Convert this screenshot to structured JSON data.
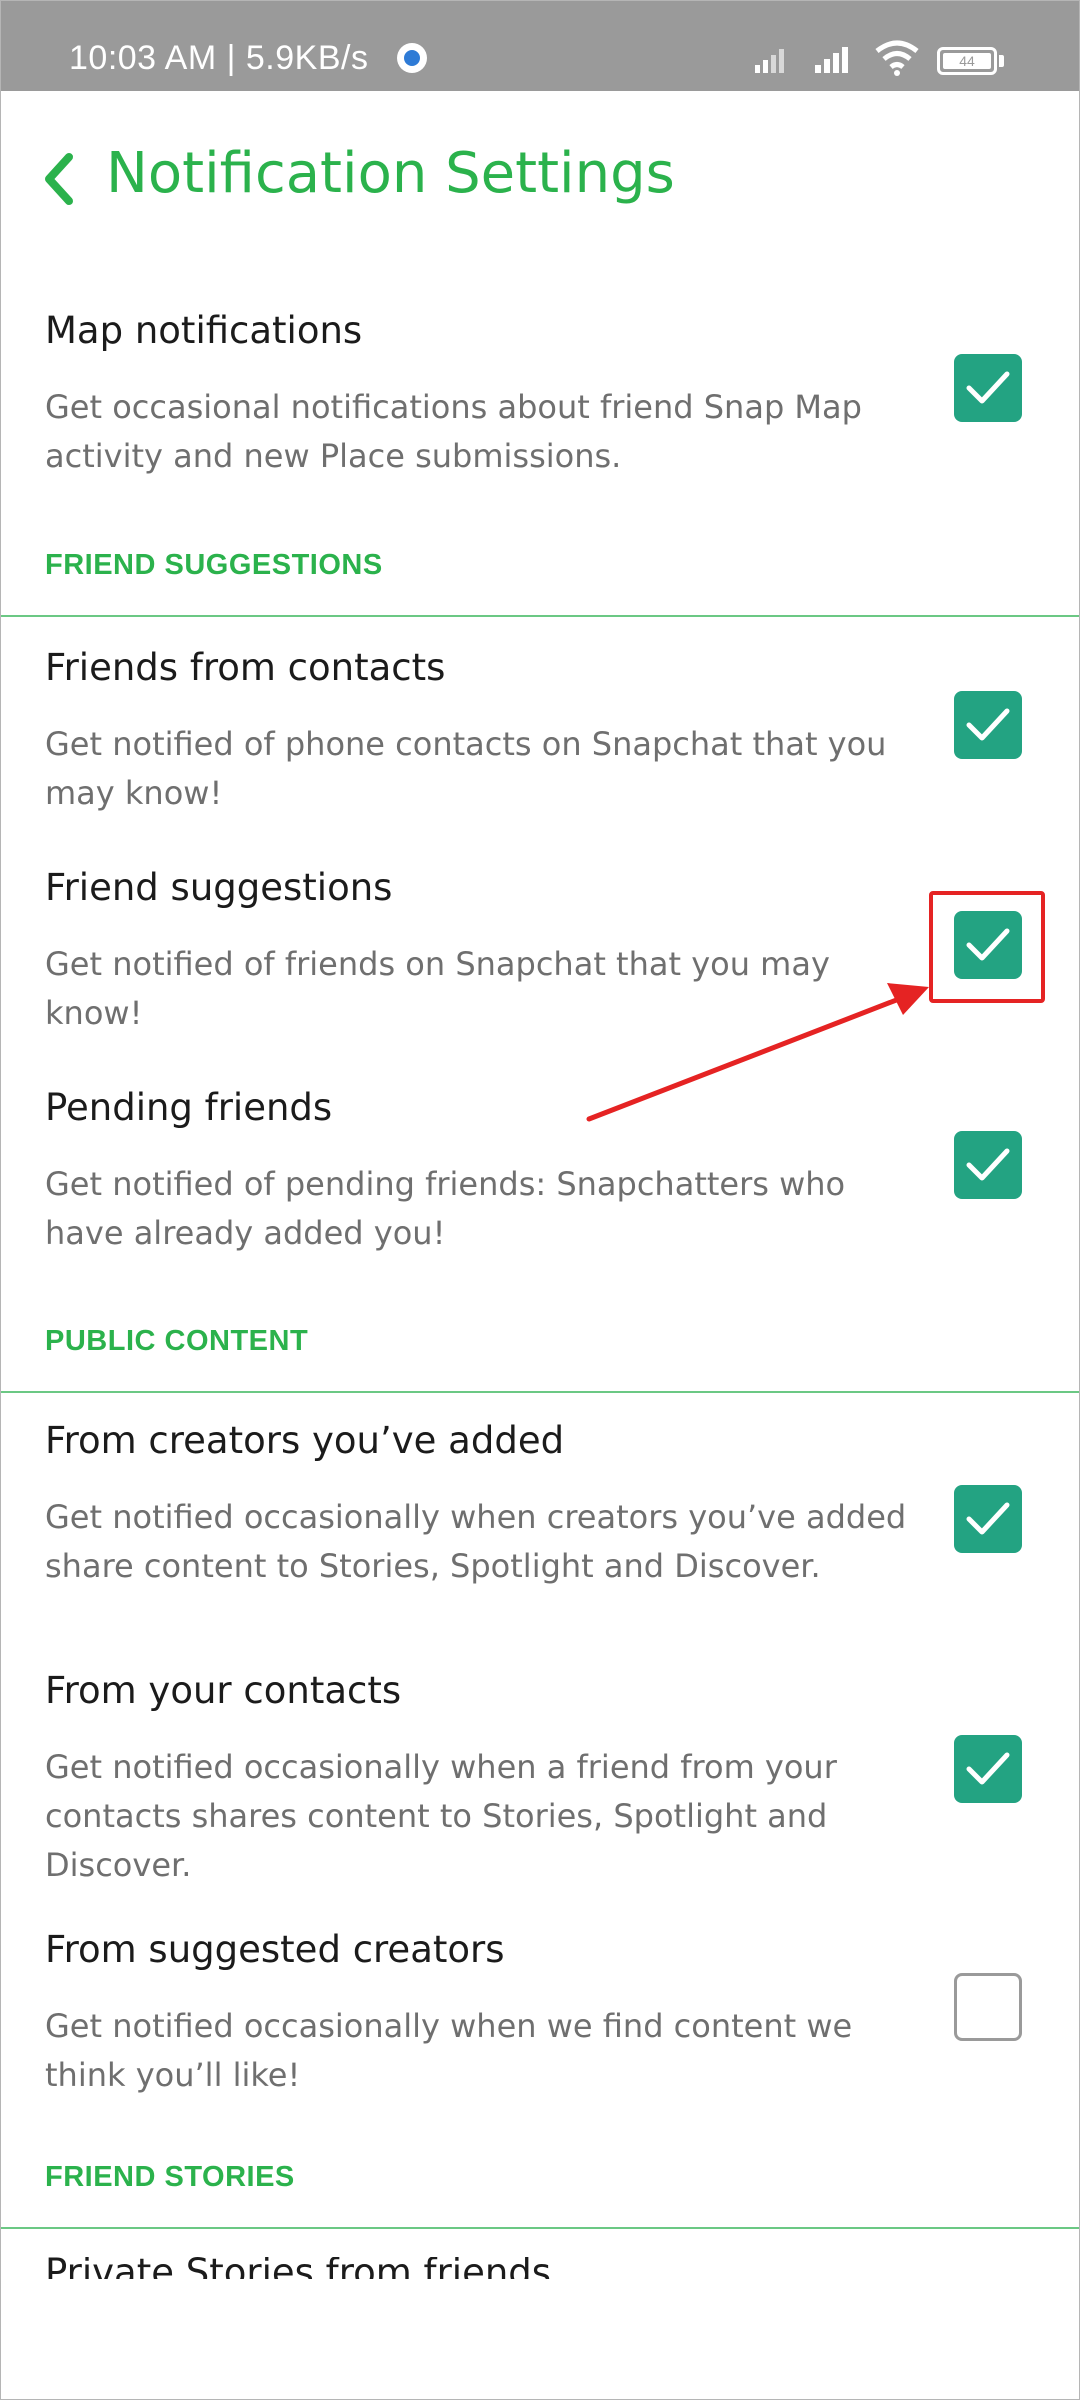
{
  "status_bar": {
    "time_speed": "10:03 AM | 5.9KB/s",
    "battery": "44"
  },
  "header": {
    "title": "Notification Settings"
  },
  "items": [
    {
      "title": "Map notifications",
      "desc": "Get occasional notifications about friend Snap Map activity and new Place submissions.",
      "checked": true
    },
    {
      "title": "Friends from contacts",
      "desc": "Get notified of phone contacts on Snapchat that you may know!",
      "checked": true
    },
    {
      "title": "Friend suggestions",
      "desc": "Get notified of friends on Snapchat that you may know!",
      "checked": true
    },
    {
      "title": "Pending friends",
      "desc": "Get notified of pending friends: Snapchatters who have already added you!",
      "checked": true
    },
    {
      "title": "From creators you’ve added",
      "desc": "Get notified occasionally when creators you’ve added share content to Stories, Spotlight and Discover.",
      "checked": true
    },
    {
      "title": "From your contacts",
      "desc": "Get notified occasionally when a friend from your contacts shares content to Stories, Spotlight and Discover.",
      "checked": true
    },
    {
      "title": "From suggested creators",
      "desc": "Get notified occasionally when we find content we think you’ll like!",
      "checked": false
    }
  ],
  "sections": {
    "friend_suggestions": "FRIEND SUGGESTIONS",
    "public_content": "PUBLIC CONTENT",
    "friend_stories": "FRIEND STORIES"
  },
  "partial_item_title": "Private Stories from friends",
  "colors": {
    "accent_green": "#2bb24c",
    "checkbox_green": "#23a382",
    "annotation_red": "#e52323"
  }
}
